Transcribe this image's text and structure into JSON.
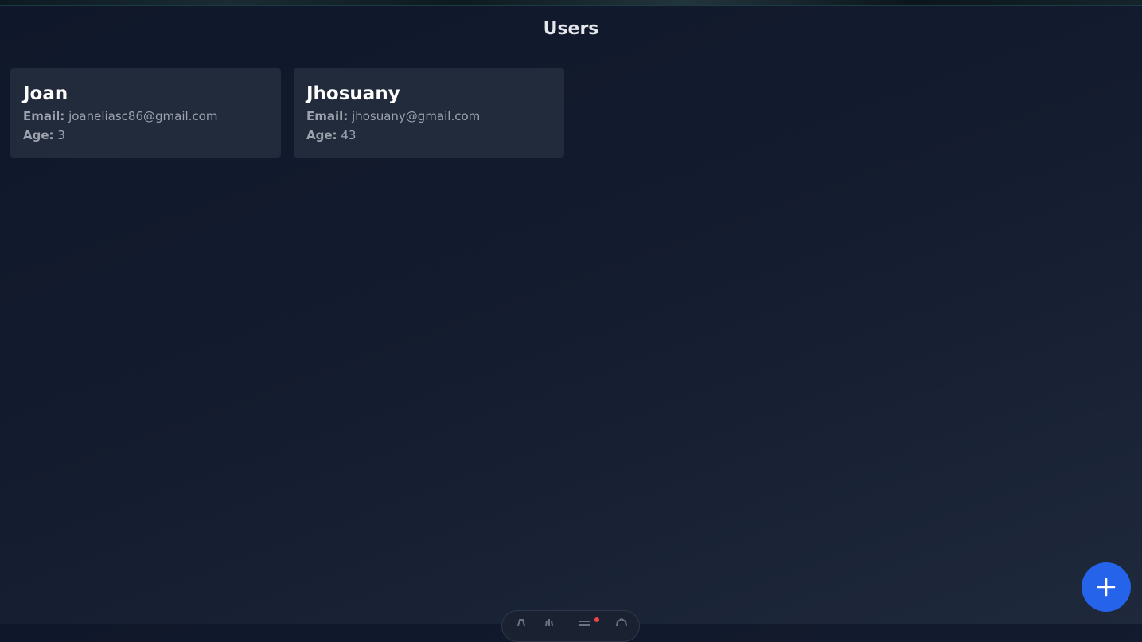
{
  "page": {
    "title": "Users"
  },
  "users": [
    {
      "name": "Joan",
      "email_label": "Email:",
      "email": "joaneliasc86@gmail.com",
      "age_label": "Age:",
      "age": "3"
    },
    {
      "name": "Jhosuany",
      "email_label": "Email:",
      "email": "jhosuany@gmail.com",
      "age_label": "Age:",
      "age": "43"
    }
  ],
  "colors": {
    "background": "#0f172a",
    "card": "#222b3b",
    "accent": "#2563eb",
    "muted_text": "#9ca3af"
  },
  "icons": {
    "fab": "plus-icon"
  }
}
